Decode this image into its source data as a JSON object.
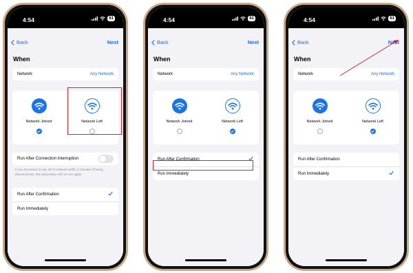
{
  "status": {
    "time": "4:54",
    "battery": "61"
  },
  "nav": {
    "back": "Back",
    "next": "Next"
  },
  "title": "When",
  "network": {
    "label": "Network",
    "value": "Any Network"
  },
  "options": {
    "joined": "Network Joined",
    "left": "Network Left"
  },
  "interruption": {
    "label": "Run After Connection Interruption",
    "toggle_on": false,
    "footnote": "If you reconnect to any Wi-Fi network within 3 minutes of being disconnected, this automation will not run again."
  },
  "run": {
    "confirmation": "Run After Confirmation",
    "immediately": "Run Immediately"
  },
  "colors": {
    "accent": "#1a73e8",
    "highlight": "#d3262d",
    "frame": "#c9a98a"
  },
  "phones": [
    {
      "selected_option": "left",
      "selected_run": "confirmation",
      "highlight": "network-left-option"
    },
    {
      "selected_option": "left",
      "selected_run": "confirmation",
      "highlight": "run-immediately-row"
    },
    {
      "selected_option": "left",
      "selected_run": "immediately",
      "highlight": "next-button-arrow"
    }
  ]
}
